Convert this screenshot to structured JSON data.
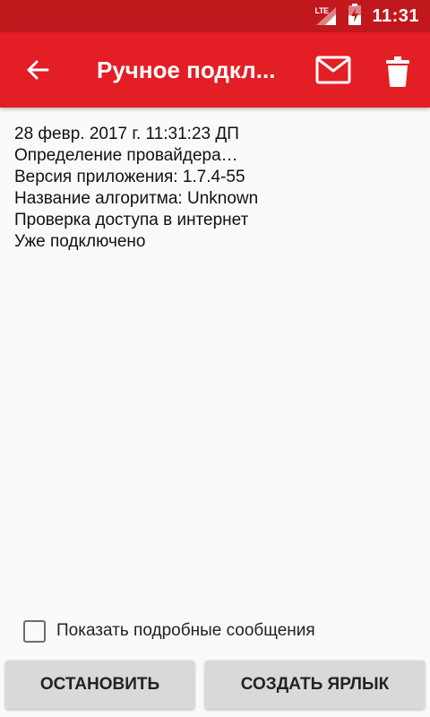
{
  "status_bar": {
    "network": "LTE",
    "time": "11:31"
  },
  "app_bar": {
    "title": "Ручное подкл...",
    "back_icon": "arrow-left-icon",
    "mail_icon": "mail-icon",
    "trash_icon": "trash-icon"
  },
  "log": {
    "lines": [
      "28 февр. 2017 г. 11:31:23 ДП",
      "Определение провайдера…",
      "Версия приложения: 1.7.4-55",
      "Название алгоритма: Unknown",
      "Проверка доступа в интернет",
      "Уже подключено"
    ]
  },
  "options": {
    "verbose_label": "Показать подробные сообщения",
    "verbose_checked": false
  },
  "buttons": {
    "stop": "ОСТАНОВИТЬ",
    "shortcut": "СОЗДАТЬ ЯРЛЫК"
  },
  "colors": {
    "status_bar": "#c1181e",
    "app_bar": "#e31e24"
  }
}
